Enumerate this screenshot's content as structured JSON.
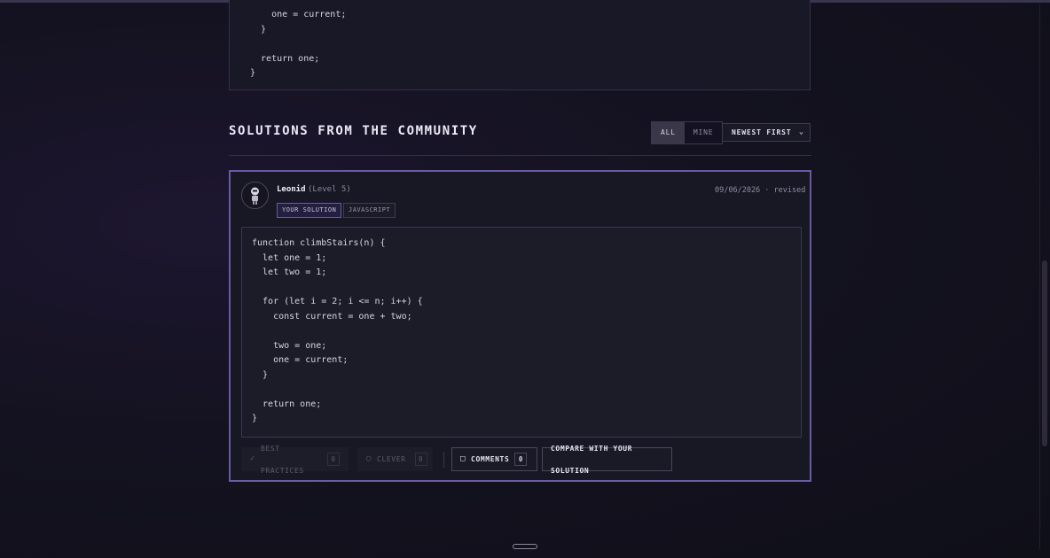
{
  "top_code": "    one = current;\n  }\n\n  return one;\n}",
  "section": {
    "title": "SOLUTIONS FROM THE COMMUNITY",
    "filters": [
      "ALL",
      "MINE"
    ],
    "active_filter": "ALL",
    "sort_label": "NEWEST FIRST"
  },
  "solution": {
    "author": "Leonid",
    "level": "(Level 5)",
    "tags": [
      "YOUR SOLUTION",
      "JAVASCRIPT"
    ],
    "date": "09/06/2026 · revised",
    "code": "function climbStairs(n) {\n  let one = 1;\n  let two = 1;\n\n  for (let i = 2; i <= n; i++) {\n    const current = one + two;\n\n    two = one;\n    one = current;\n  }\n\n  return one;\n}",
    "actions": {
      "best_practices": {
        "label": "BEST PRACTICES",
        "count": "0"
      },
      "clever": {
        "label": "CLEVER",
        "count": "0"
      },
      "comments": {
        "label": "COMMENTS",
        "count": "0"
      },
      "compare": {
        "label": "COMPARE WITH YOUR SOLUTION"
      }
    }
  },
  "icons": {
    "best_practices": "check-icon",
    "clever": "lightbulb-icon",
    "comments": "comment-icon",
    "sort": "chevron-down-icon"
  },
  "colors": {
    "accent": "#6a5aa3",
    "background": "#141220",
    "card": "#181724"
  }
}
